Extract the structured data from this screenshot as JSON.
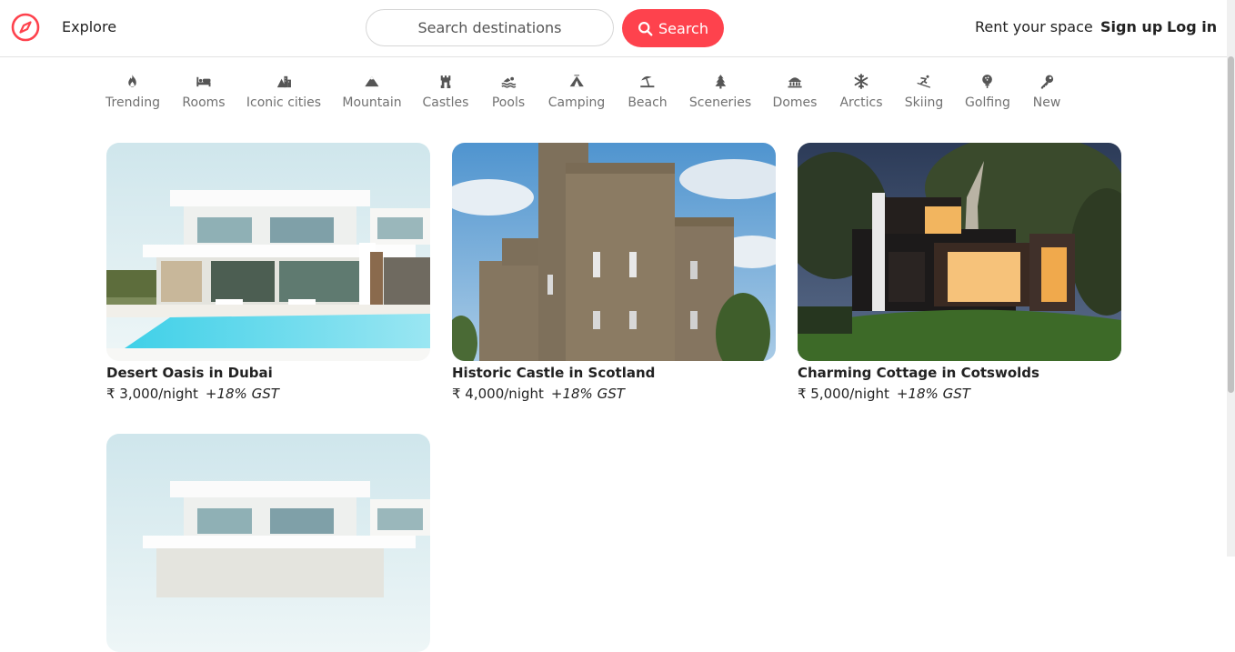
{
  "navbar": {
    "explore_label": "Explore",
    "search_placeholder": "Search destinations",
    "search_button_label": "Search",
    "rent_label": "Rent your space",
    "signup_label": "Sign up",
    "login_label": "Log in",
    "brand_color": "#fe424d"
  },
  "filters": [
    {
      "label": "Trending",
      "icon": "fire-icon"
    },
    {
      "label": "Rooms",
      "icon": "bed-icon"
    },
    {
      "label": "Iconic cities",
      "icon": "city-icon"
    },
    {
      "label": "Mountain",
      "icon": "mountain-icon"
    },
    {
      "label": "Castles",
      "icon": "castle-icon"
    },
    {
      "label": "Pools",
      "icon": "swimmer-icon"
    },
    {
      "label": "Camping",
      "icon": "tent-icon"
    },
    {
      "label": "Beach",
      "icon": "umbrella-beach-icon"
    },
    {
      "label": "Sceneries",
      "icon": "tree-icon"
    },
    {
      "label": "Domes",
      "icon": "dome-icon"
    },
    {
      "label": "Arctics",
      "icon": "snowflake-icon"
    },
    {
      "label": "Skiing",
      "icon": "skier-icon"
    },
    {
      "label": "Golfing",
      "icon": "golf-ball-icon"
    },
    {
      "label": "New",
      "icon": "key-icon"
    }
  ],
  "listings": [
    {
      "title": "Desert Oasis in Dubai",
      "price": "₹ 3,000/night",
      "tax": "+18% GST",
      "image": "modern-villa-with-pool"
    },
    {
      "title": "Historic Castle in Scotland",
      "price": "₹ 4,000/night",
      "tax": "+18% GST",
      "image": "stone-castle"
    },
    {
      "title": "Charming Cottage in Cotswolds",
      "price": "₹ 5,000/night",
      "tax": "+18% GST",
      "image": "modern-house-at-dusk"
    },
    {
      "title": "",
      "price": "",
      "tax": "",
      "image": "modern-villa-with-pool"
    }
  ]
}
